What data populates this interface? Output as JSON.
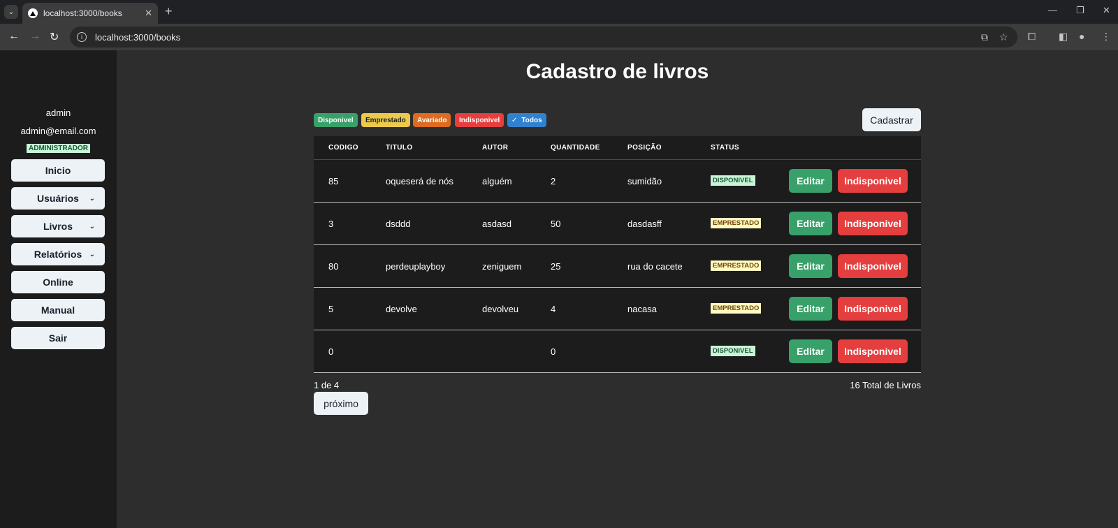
{
  "browser": {
    "tab_title": "localhost:3000/books",
    "url": "localhost:3000/books"
  },
  "sidebar": {
    "user_name": "admin",
    "user_email": "admin@email.com",
    "role": "ADMINISTRADOR",
    "items": [
      {
        "label": "Inicio",
        "dropdown": false
      },
      {
        "label": "Usuários",
        "dropdown": true
      },
      {
        "label": "Livros",
        "dropdown": true
      },
      {
        "label": "Relatórios",
        "dropdown": true
      },
      {
        "label": "Online",
        "dropdown": false
      },
      {
        "label": "Manual",
        "dropdown": false
      },
      {
        "label": "Sair",
        "dropdown": false
      }
    ]
  },
  "main": {
    "title": "Cadastro de livros",
    "filters": {
      "disponivel": "Disponivel",
      "emprestado": "Emprestado",
      "avariado": "Avariado",
      "indisponivel": "Indisponivel",
      "todos": "Todos"
    },
    "cadastrar_label": "Cadastrar",
    "table": {
      "headers": [
        "CODIGO",
        "TITULO",
        "AUTOR",
        "QUANTIDADE",
        "POSIÇÃO",
        "STATUS"
      ],
      "rows": [
        {
          "codigo": "85",
          "titulo": "oqueserá de nós",
          "autor": "alguém",
          "quantidade": "2",
          "posicao": "sumidão",
          "status": "DISPONIVEL"
        },
        {
          "codigo": "3",
          "titulo": "dsddd",
          "autor": "asdasd",
          "quantidade": "50",
          "posicao": "dasdasff",
          "status": "EMPRESTADO"
        },
        {
          "codigo": "80",
          "titulo": "perdeuplayboy",
          "autor": "zeniguem",
          "quantidade": "25",
          "posicao": "rua do cacete",
          "status": "EMPRESTADO"
        },
        {
          "codigo": "5",
          "titulo": "devolve",
          "autor": "devolveu",
          "quantidade": "4",
          "posicao": "nacasa",
          "status": "EMPRESTADO"
        },
        {
          "codigo": "0",
          "titulo": "",
          "autor": "",
          "quantidade": "0",
          "posicao": "",
          "status": "DISPONIVEL"
        }
      ],
      "edit_label": "Editar",
      "indisponivel_label": "Indisponivel"
    },
    "pagination": {
      "page_info": "1 de 4",
      "total": "16 Total de Livros",
      "next_label": "próximo"
    }
  }
}
